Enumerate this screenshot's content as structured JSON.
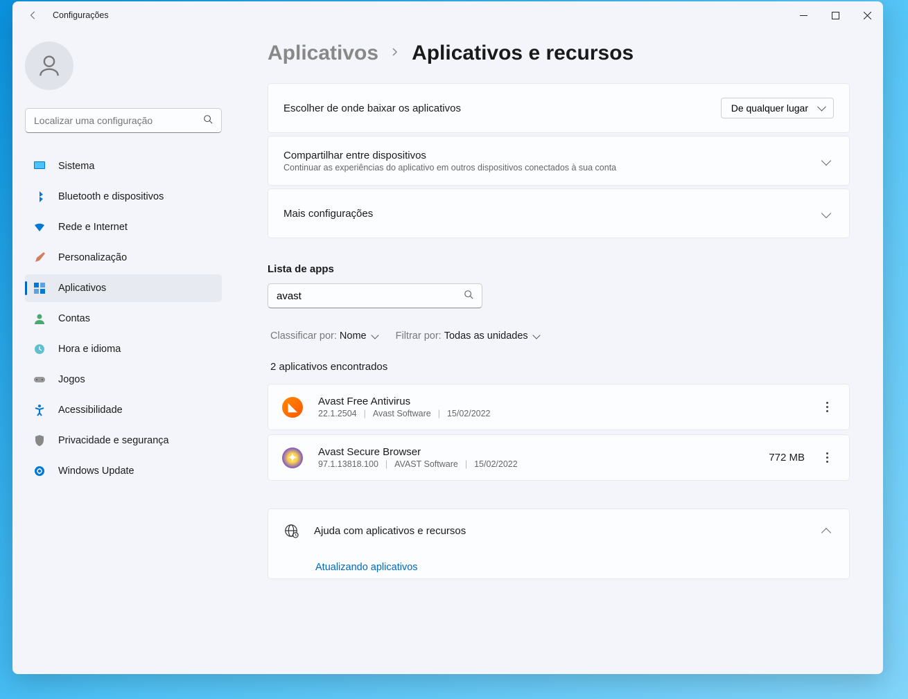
{
  "window": {
    "title": "Configurações"
  },
  "search": {
    "placeholder": "Localizar uma configuração"
  },
  "sidebar": {
    "items": [
      {
        "label": "Sistema",
        "icon": "monitor"
      },
      {
        "label": "Bluetooth e dispositivos",
        "icon": "bluetooth"
      },
      {
        "label": "Rede e Internet",
        "icon": "wifi"
      },
      {
        "label": "Personalização",
        "icon": "brush"
      },
      {
        "label": "Aplicativos",
        "icon": "apps"
      },
      {
        "label": "Contas",
        "icon": "person"
      },
      {
        "label": "Hora e idioma",
        "icon": "clock"
      },
      {
        "label": "Jogos",
        "icon": "gamepad"
      },
      {
        "label": "Acessibilidade",
        "icon": "accessibility"
      },
      {
        "label": "Privacidade e segurança",
        "icon": "shield"
      },
      {
        "label": "Windows Update",
        "icon": "update"
      }
    ],
    "active_index": 4
  },
  "breadcrumb": {
    "parent": "Aplicativos",
    "current": "Aplicativos e recursos"
  },
  "cards": {
    "source": {
      "title": "Escolher de onde baixar os aplicativos",
      "value": "De qualquer lugar"
    },
    "share": {
      "title": "Compartilhar entre dispositivos",
      "sub": "Continuar as experiências do aplicativo em outros dispositivos conectados à sua conta"
    },
    "more": {
      "title": "Mais configurações"
    }
  },
  "apps_section": {
    "heading": "Lista de apps",
    "search_value": "avast",
    "sort_label": "Classificar por:",
    "sort_value": "Nome",
    "filter_label": "Filtrar por:",
    "filter_value": "Todas as unidades",
    "count": "2 aplicativos encontrados"
  },
  "apps": [
    {
      "name": "Avast Free Antivirus",
      "version": "22.1.2504",
      "publisher": "Avast Software",
      "date": "15/02/2022",
      "size": "",
      "icon_bg": "linear-gradient(135deg,#ff8a00,#ff5400)",
      "icon_letter": "◣"
    },
    {
      "name": "Avast Secure Browser",
      "version": "97.1.13818.100",
      "publisher": "AVAST Software",
      "date": "15/02/2022",
      "size": "772 MB",
      "icon_bg": "radial-gradient(circle,#ffd54f 30%,#7e57c2 70%)",
      "icon_letter": "✦"
    }
  ],
  "help": {
    "title": "Ajuda com aplicativos e recursos",
    "link": "Atualizando aplicativos"
  }
}
